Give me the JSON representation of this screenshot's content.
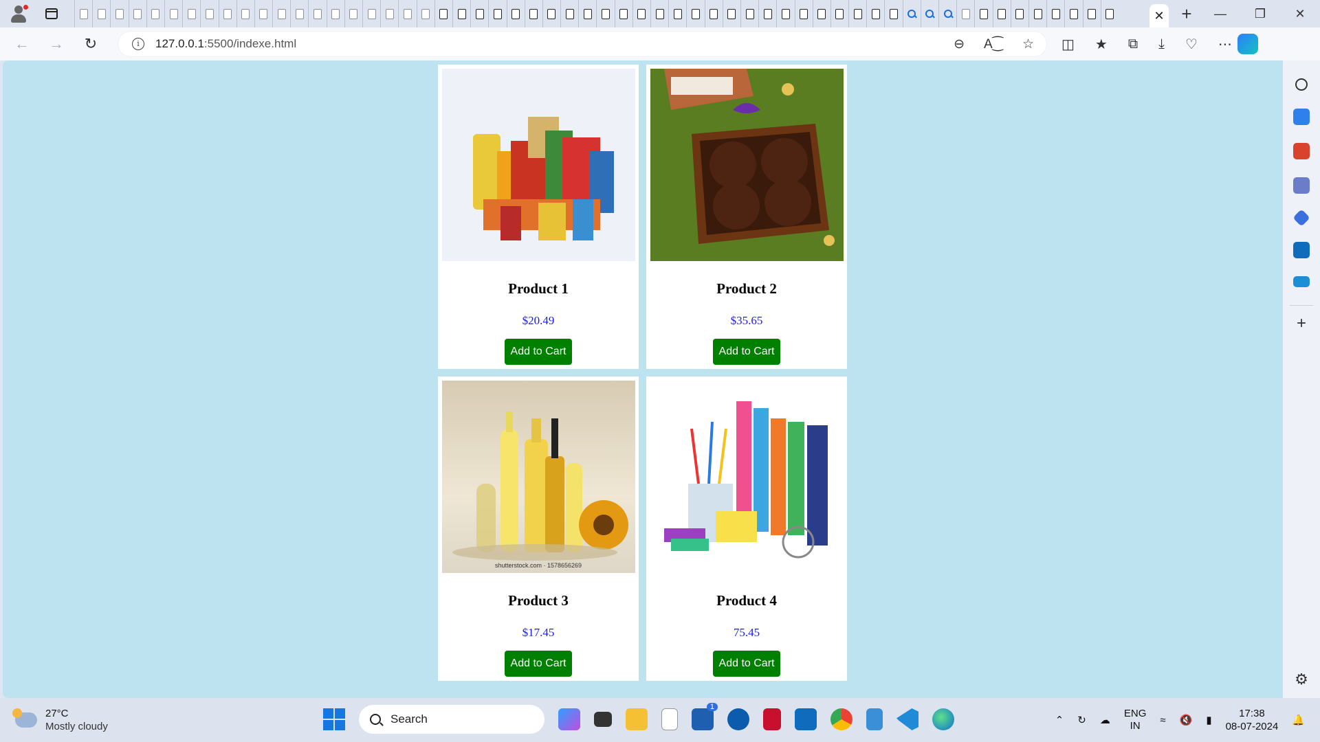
{
  "browser": {
    "url_host": "127.0.0.1",
    "url_rest": ":5500/indexe.html",
    "tab_close": "✕",
    "new_tab": "+"
  },
  "products": [
    {
      "title": "Product 1",
      "price": "$20.49",
      "button": "Add to Cart",
      "image": "grocery-pack"
    },
    {
      "title": "Product 2",
      "price": "$35.65",
      "button": "Add to Cart",
      "image": "chocolate-box"
    },
    {
      "title": "Product 3",
      "price": "$17.45",
      "button": "Add to Cart",
      "image": "oil-bottles",
      "watermark": "shutterstock.com · 1578656269"
    },
    {
      "title": "Product 4",
      "price": "75.45",
      "button": "Add to Cart",
      "image": "stationery"
    }
  ],
  "taskbar": {
    "temperature": "27°C",
    "weather": "Mostly cloudy",
    "search_label": "Search",
    "lang_top": "ENG",
    "lang_bottom": "IN",
    "time": "17:38",
    "date": "08-07-2024",
    "store_badge": "1"
  },
  "colors": {
    "page_bg": "#bde3f1",
    "button": "#008000",
    "price": "#1a1af0"
  }
}
